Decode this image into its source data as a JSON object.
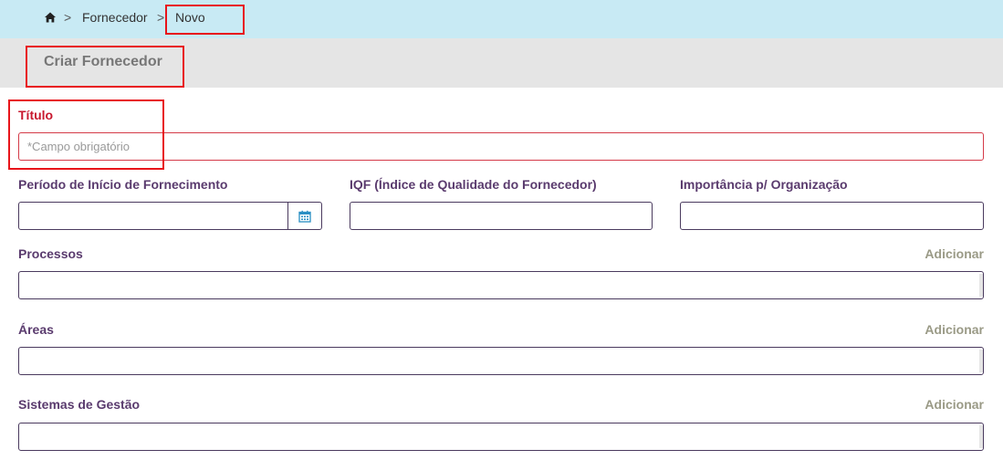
{
  "breadcrumb": {
    "home_icon": "home-icon",
    "separator": ">",
    "items": [
      "Fornecedor",
      "Novo"
    ]
  },
  "header": {
    "title": "Criar Fornecedor"
  },
  "form": {
    "titulo": {
      "label": "Título",
      "placeholder": "*Campo obrigatório",
      "value": ""
    },
    "periodo": {
      "label": "Período de Início de Fornecimento",
      "value": "",
      "icon": "calendar-icon"
    },
    "iqf": {
      "label": "IQF (Índice de Qualidade do Fornecedor)",
      "value": ""
    },
    "importancia": {
      "label": "Importância p/ Organização",
      "value": ""
    },
    "processos": {
      "label": "Processos",
      "add_label": "Adicionar"
    },
    "areas": {
      "label": "Áreas",
      "add_label": "Adicionar"
    },
    "sistemas": {
      "label": "Sistemas de Gestão",
      "add_label": "Adicionar"
    }
  },
  "colors": {
    "breadcrumb_bg": "#c8eaf4",
    "header_bg": "#e5e5e5",
    "label": "#5a3b6e",
    "required": "#c8192f",
    "highlight": "#e8141a",
    "add_link": "#9a9a86"
  }
}
